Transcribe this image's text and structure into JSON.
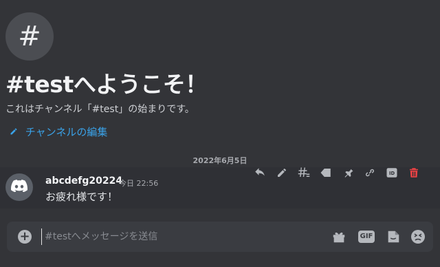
{
  "welcome": {
    "channel_icon_glyph": "#",
    "title": "#testへようこそ！",
    "description": "これはチャンネル「#test」の始まりです。",
    "edit_link": "チャンネルの編集"
  },
  "date_separator": "2022年6月5日",
  "message": {
    "username": "abcdefg20224",
    "timestamp": "今日 22:56",
    "text": "お疲れ様です！",
    "avatar_icon": "discord-logo-icon"
  },
  "toolbar_icons": [
    "reply-icon",
    "edit-icon",
    "thread-icon",
    "tag-icon",
    "pin-icon",
    "link-icon",
    "id-icon",
    "delete-icon"
  ],
  "composer": {
    "placeholder": "#testへメッセージを送信",
    "gif_label": "GIF"
  },
  "colors": {
    "background": "#333438",
    "link": "#3aa2e8",
    "danger": "#ed4245"
  }
}
